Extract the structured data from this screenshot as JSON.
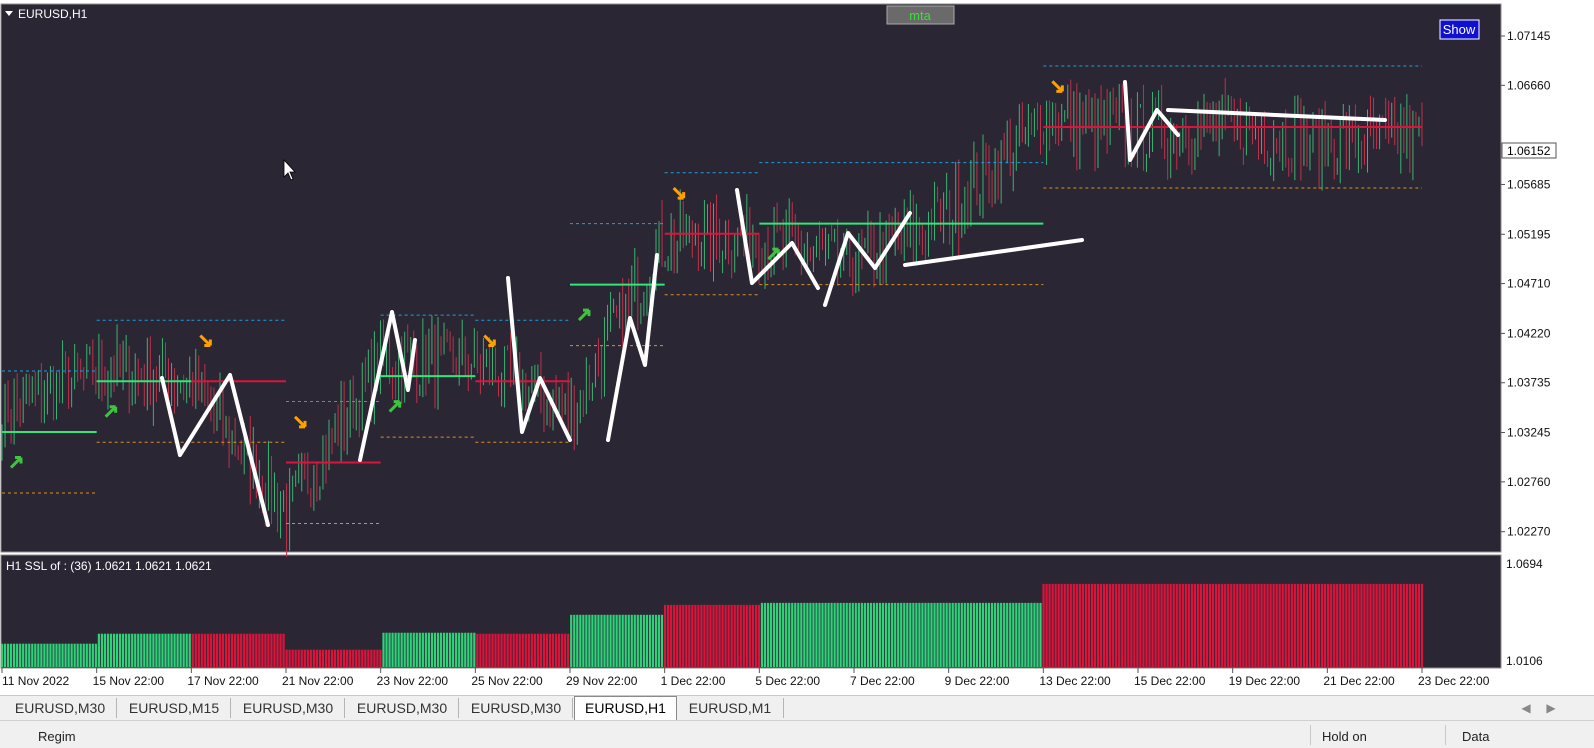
{
  "window": {
    "symbol_title": "EURUSD,H1",
    "mta_button": "mta",
    "show_button": "Show"
  },
  "price_axis": {
    "labels": [
      "1.07145",
      "1.06660",
      "1.05685",
      "1.05195",
      "1.04710",
      "1.04220",
      "1.03735",
      "1.03245",
      "1.02760",
      "1.02270"
    ],
    "label_values": [
      1.07145,
      1.0666,
      1.05685,
      1.05195,
      1.0471,
      1.0422,
      1.03735,
      1.03245,
      1.0276,
      1.0227
    ],
    "current_price": "1.06152",
    "current_price_value": 1.06152
  },
  "indicator": {
    "header": "H1  SSL of : (36) 1.0621 1.0621 1.0621",
    "axis_top": "1.0694",
    "axis_bottom": "1.0106",
    "green_color": "#2ed27a",
    "red_color": "#dc143c"
  },
  "time_axis": {
    "labels": [
      "11 Nov 2022",
      "15 Nov 22:00",
      "17 Nov 22:00",
      "21 Nov 22:00",
      "23 Nov 22:00",
      "25 Nov 22:00",
      "29 Nov 22:00",
      "1 Dec 22:00",
      "5 Dec 22:00",
      "7 Dec 22:00",
      "9 Dec 22:00",
      "13 Dec 22:00",
      "15 Dec 22:00",
      "19 Dec 22:00",
      "21 Dec 22:00",
      "23 Dec 22:00"
    ]
  },
  "chart_data": {
    "type": "line",
    "symbol": "EURUSD",
    "timeframe": "H1",
    "x": [
      "11 Nov 2022",
      "15 Nov 22:00",
      "17 Nov 22:00",
      "21 Nov 22:00",
      "23 Nov 22:00",
      "25 Nov 22:00",
      "29 Nov 22:00",
      "1 Dec 22:00",
      "5 Dec 22:00",
      "7 Dec 22:00",
      "9 Dec 22:00",
      "13 Dec 22:00",
      "15 Dec 22:00",
      "19 Dec 22:00",
      "21 Dec 22:00",
      "23 Dec 22:00"
    ],
    "price_close_approx": [
      1.0345,
      1.0385,
      1.0375,
      1.0245,
      1.0395,
      1.0395,
      1.0345,
      1.0515,
      1.0515,
      1.049,
      1.054,
      1.0635,
      1.062,
      1.0625,
      1.061,
      1.0615
    ],
    "ylim": [
      1.0208,
      1.0745
    ],
    "ssl_baseline": [
      {
        "from": "11 Nov 2022",
        "to": "15 Nov 22:00",
        "value": 1.0325,
        "trend": "up"
      },
      {
        "from": "15 Nov 22:00",
        "to": "17 Nov 22:00",
        "value": 1.0375,
        "trend": "up"
      },
      {
        "from": "17 Nov 22:00",
        "to": "21 Nov 22:00",
        "value": 1.0375,
        "trend": "down"
      },
      {
        "from": "21 Nov 22:00",
        "to": "23 Nov 22:00",
        "value": 1.0295,
        "trend": "down"
      },
      {
        "from": "23 Nov 22:00",
        "to": "25 Nov 22:00",
        "value": 1.038,
        "trend": "up"
      },
      {
        "from": "25 Nov 22:00",
        "to": "29 Nov 22:00",
        "value": 1.0375,
        "trend": "down"
      },
      {
        "from": "29 Nov 22:00",
        "to": "1 Dec 22:00",
        "value": 1.047,
        "trend": "up"
      },
      {
        "from": "1 Dec 22:00",
        "to": "5 Dec 22:00",
        "value": 1.052,
        "trend": "down"
      },
      {
        "from": "5 Dec 22:00",
        "to": "13 Dec 22:00",
        "value": 1.053,
        "trend": "up"
      },
      {
        "from": "13 Dec 22:00",
        "to": "23 Dec 22:00",
        "value": 1.0625,
        "trend": "down"
      }
    ],
    "indicator_panel": {
      "name": "SSL of",
      "period": 36,
      "values": [
        1.0621,
        1.0621,
        1.0621
      ],
      "ylim": [
        1.0106,
        1.0694
      ]
    }
  },
  "tabs": [
    {
      "label": "EURUSD,M30",
      "active": false
    },
    {
      "label": "EURUSD,M15",
      "active": false
    },
    {
      "label": "EURUSD,M30",
      "active": false
    },
    {
      "label": "EURUSD,M30",
      "active": false
    },
    {
      "label": "EURUSD,M30",
      "active": false
    },
    {
      "label": "EURUSD,H1",
      "active": true
    },
    {
      "label": "EURUSD,M1",
      "active": false
    }
  ],
  "status": {
    "left": "Regim",
    "mid": "Hold on",
    "right": "Data"
  }
}
